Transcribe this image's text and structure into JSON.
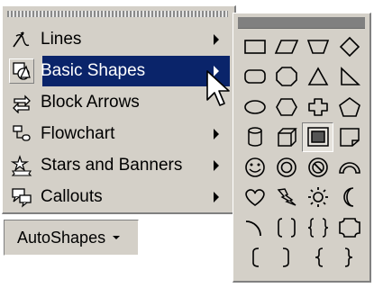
{
  "menu": {
    "items": [
      {
        "label": "Lines",
        "icon": "lines-icon",
        "has_submenu": true
      },
      {
        "label": "Basic Shapes",
        "icon": "basic-shapes-icon",
        "has_submenu": true,
        "active": true
      },
      {
        "label": "Block Arrows",
        "icon": "block-arrows-icon",
        "has_submenu": true
      },
      {
        "label": "Flowchart",
        "icon": "flowchart-icon",
        "has_submenu": true
      },
      {
        "label": "Stars and Banners",
        "icon": "stars-banners-icon",
        "has_submenu": true
      },
      {
        "label": "Callouts",
        "icon": "callouts-icon",
        "has_submenu": true
      }
    ]
  },
  "toolbar": {
    "autoshapes_label": "AutoShapes"
  },
  "palette": {
    "shapes": [
      "rectangle",
      "parallelogram",
      "trapezoid",
      "diamond",
      "rounded-rectangle",
      "octagon",
      "isosceles-triangle",
      "right-triangle",
      "oval",
      "hexagon",
      "cross",
      "pentagon",
      "can",
      "cube",
      "bevel",
      "folded-corner",
      "smiley-face",
      "donut",
      "no-symbol",
      "block-arc",
      "heart",
      "lightning-bolt",
      "sun",
      "moon",
      "arc",
      "double-bracket",
      "double-brace",
      "plaque",
      "left-bracket",
      "right-bracket",
      "left-brace",
      "right-brace"
    ]
  },
  "colors": {
    "menu_bg": "#d4d0c8",
    "highlight": "#0a246a",
    "highlight_text": "#ffffff"
  }
}
